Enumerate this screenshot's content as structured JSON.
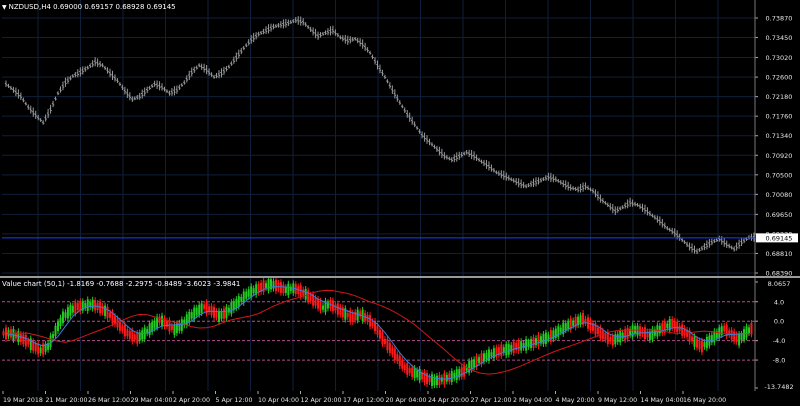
{
  "price_panel": {
    "header_arrow": "▼",
    "header": "NZDUSD,H4  0.69000 0.69157 0.68928 0.69145",
    "current_price_label": "0.69145",
    "y_ticks": [
      "0.73870",
      "0.73450",
      "0.73020",
      "0.72600",
      "0.72180",
      "0.71760",
      "0.71340",
      "0.70920",
      "0.70500",
      "0.70080",
      "0.69650",
      "0.69230",
      "0.68810",
      "0.68390"
    ]
  },
  "indicator_panel": {
    "header": "Value chart (50,1) -1.8169 -0.7688 -2.2975 -0.8489 -3.6023 -3.9841",
    "y_ticks": [
      "8.0657",
      "4.0",
      "0.0",
      "-4.0",
      "-8.0",
      "-13.7482"
    ]
  },
  "x_axis": {
    "labels": [
      "19 Mar 2018",
      "21 Mar 20:00",
      "26 Mar 12:00",
      "29 Mar 04:00",
      "2 Apr 20:00",
      "5 Apr 12:00",
      "10 Apr 04:00",
      "12 Apr 20:00",
      "17 Apr 12:00",
      "20 Apr 04:00",
      "24 Apr 20:00",
      "27 Apr 12:00",
      "2 May 04:00",
      "4 May 20:00",
      "9 May 12:00",
      "14 May 04:00",
      "16 May 20:00"
    ]
  },
  "colors": {
    "background": "#000000",
    "grid": "#0f1f3a",
    "price_bars": "#9a9a9a",
    "current_price_line": "#1e3cff",
    "bull": "#22cc22",
    "bear": "#ff1a1a",
    "fast_ma": "#3b7ddd",
    "slow_ma": "#d01818",
    "level_lines": "#b0508a"
  },
  "chart_data": [
    {
      "type": "line",
      "title": "NZDUSD,H4",
      "series": [
        {
          "name": "NZDUSD,H4",
          "values": [
            0.7245,
            0.7232,
            0.7218,
            0.7195,
            0.7178,
            0.7162,
            0.719,
            0.7225,
            0.7248,
            0.7262,
            0.727,
            0.728,
            0.7292,
            0.7285,
            0.7268,
            0.7252,
            0.723,
            0.7212,
            0.7218,
            0.7232,
            0.7245,
            0.7238,
            0.7225,
            0.7232,
            0.7248,
            0.727,
            0.7285,
            0.7275,
            0.726,
            0.7268,
            0.7282,
            0.7302,
            0.7322,
            0.734,
            0.7352,
            0.736,
            0.7368,
            0.7372,
            0.7376,
            0.7382,
            0.7378,
            0.7362,
            0.7348,
            0.7355,
            0.736,
            0.7345,
            0.7338,
            0.7342,
            0.733,
            0.7312,
            0.7285,
            0.726,
            0.7232,
            0.7205,
            0.718,
            0.7158,
            0.7135,
            0.712,
            0.7105,
            0.709,
            0.7082,
            0.709,
            0.7098,
            0.709,
            0.7078,
            0.7068,
            0.7055,
            0.7048,
            0.704,
            0.7032,
            0.7025,
            0.7032,
            0.7038,
            0.7045,
            0.704,
            0.703,
            0.7022,
            0.7018,
            0.7025,
            0.7015,
            0.6998,
            0.6985,
            0.6972,
            0.698,
            0.699,
            0.6985,
            0.6975,
            0.6962,
            0.695,
            0.6935,
            0.6925,
            0.691,
            0.6895,
            0.6885,
            0.6895,
            0.6905,
            0.6912,
            0.69,
            0.689,
            0.6905,
            0.6915
          ]
        }
      ],
      "ylim": [
        0.6839,
        0.7387
      ]
    },
    {
      "type": "bar",
      "title": "Value chart (50,1)",
      "series": [
        {
          "name": "",
          "values": [
            -2.5,
            -3.2,
            -4.0,
            -5.1,
            -6.0,
            -5.2,
            -2.0,
            0.8,
            2.2,
            3.0,
            3.2,
            3.5,
            2.8,
            1.8,
            0.2,
            -1.5,
            -2.8,
            -3.5,
            -2.5,
            -1.2,
            0.3,
            -0.5,
            -1.8,
            -0.8,
            0.8,
            2.0,
            3.0,
            2.2,
            1.0,
            1.8,
            3.2,
            4.5,
            5.8,
            6.5,
            7.2,
            7.6,
            7.2,
            6.4,
            6.8,
            6.2,
            5.2,
            4.0,
            2.8,
            3.5,
            2.5,
            1.5,
            0.8,
            1.5,
            0.6,
            -1.0,
            -3.5,
            -5.5,
            -7.5,
            -9.5,
            -10.5,
            -11.0,
            -11.8,
            -12.3,
            -12.0,
            -11.6,
            -11.0,
            -10.2,
            -9.0,
            -8.0,
            -7.2,
            -6.6,
            -6.0,
            -5.8,
            -5.2,
            -5.0,
            -4.6,
            -4.0,
            -3.5,
            -2.8,
            -1.8,
            -0.8,
            -0.2,
            0.5,
            -0.8,
            -2.0,
            -3.2,
            -4.0,
            -3.2,
            -2.5,
            -1.8,
            -2.2,
            -3.0,
            -2.0,
            -1.2,
            -0.5,
            -1.5,
            -2.5,
            -4.2,
            -5.2,
            -4.0,
            -2.8,
            -1.5,
            -2.8,
            -3.8,
            -2.2,
            -1.2
          ]
        }
      ],
      "ylim": [
        -13.7482,
        8.0657
      ]
    }
  ]
}
